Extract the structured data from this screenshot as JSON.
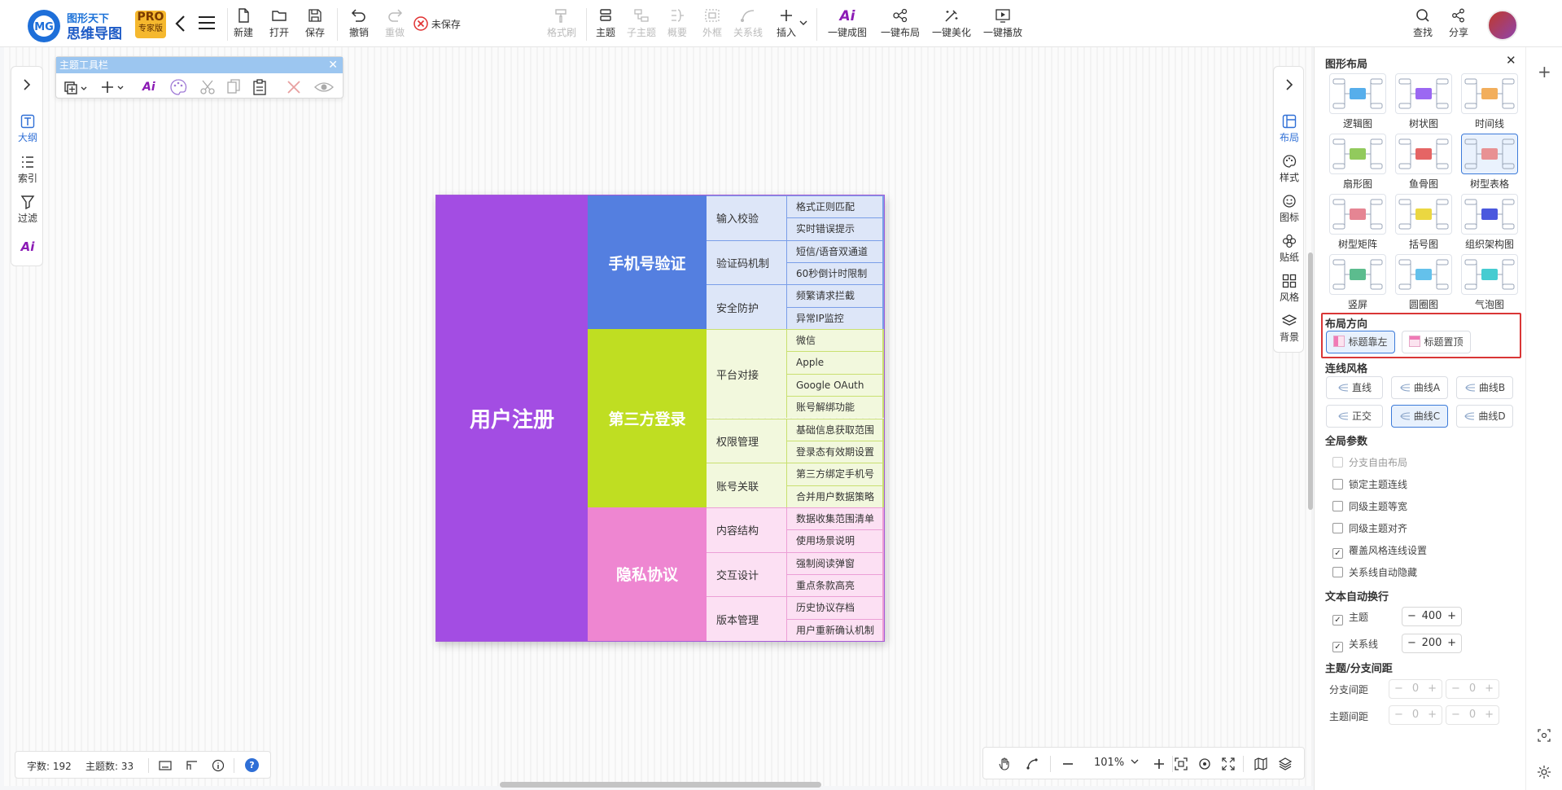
{
  "app": {
    "brand_top": "图形天下",
    "brand_name": "思维导图",
    "badge_pro": "PRO",
    "badge_edition": "专家版",
    "unsaved_label": "未保存"
  },
  "toolbar": {
    "new": "新建",
    "open": "打开",
    "save": "保存",
    "undo": "撤销",
    "redo": "重做",
    "format_brush": "格式刷",
    "topic": "主题",
    "subtopic": "子主题",
    "summary": "概要",
    "boundary": "外框",
    "relation": "关系线",
    "insert": "插入",
    "ai_map": "一键成图",
    "ai_map_icon": "Ai",
    "auto_layout": "一键布局",
    "auto_beautify": "一键美化",
    "auto_play": "一键播放",
    "find": "查找",
    "share": "分享"
  },
  "left_sidebar": {
    "outline": "大纲",
    "index": "索引",
    "filter": "过滤",
    "ai": "Ai"
  },
  "topic_toolbar": {
    "title": "主题工具栏",
    "ai": "Ai"
  },
  "right_nav": {
    "layout": "布局",
    "style": "样式",
    "icon": "图标",
    "sticker": "贴纸",
    "theme": "风格",
    "background": "背景"
  },
  "panel": {
    "layout_title": "图形布局",
    "layouts": [
      "逻辑图",
      "树状图",
      "时间线",
      "扇形图",
      "鱼骨图",
      "树型表格",
      "树型矩阵",
      "括号图",
      "组织架构图",
      "竖屏",
      "圆圈图",
      "气泡图"
    ],
    "selected_layout": "树型表格",
    "direction_title": "布局方向",
    "direction_options": [
      "标题靠左",
      "标题置顶"
    ],
    "selected_direction": "标题靠左",
    "line_style_title": "连线风格",
    "line_styles": [
      "直线",
      "曲线A",
      "曲线B",
      "正交",
      "曲线C",
      "曲线D"
    ],
    "selected_line_style": "曲线C",
    "global_title": "全局参数",
    "global_options": [
      {
        "label": "分支自由布局",
        "checked": false,
        "disabled": true
      },
      {
        "label": "锁定主题连线",
        "checked": false,
        "disabled": false
      },
      {
        "label": "同级主题等宽",
        "checked": false,
        "disabled": false
      },
      {
        "label": "同级主题对齐",
        "checked": false,
        "disabled": false
      },
      {
        "label": "覆盖风格连线设置",
        "checked": true,
        "disabled": false
      },
      {
        "label": "关系线自动隐藏",
        "checked": false,
        "disabled": false
      }
    ],
    "wrap_title": "文本自动换行",
    "wrap_topic_label": "主题",
    "wrap_topic_value": "400",
    "wrap_relation_label": "关系线",
    "wrap_relation_value": "200",
    "spacing_title": "主题/分支间距",
    "branch_spacing_label": "分支间距",
    "topic_spacing_label": "主题间距",
    "spacing_value": "0",
    "minus": "−",
    "plus": "+"
  },
  "status": {
    "char_count": "字数: 192",
    "topic_count": "主题数: 33",
    "help": "?"
  },
  "zoom": {
    "level": "101%"
  },
  "mindmap": {
    "root": "用户注册",
    "branches": [
      {
        "label": "手机号验证",
        "color": "#547fe0",
        "light": "#dde6f8",
        "line": "#7a9ee8",
        "children": [
          {
            "label": "输入校验",
            "items": [
              "格式正则匹配",
              "实时错误提示"
            ]
          },
          {
            "label": "验证码机制",
            "items": [
              "短信/语音双通道",
              "60秒倒计时限制"
            ]
          },
          {
            "label": "安全防护",
            "items": [
              "频繁请求拦截",
              "异常IP监控"
            ]
          }
        ]
      },
      {
        "label": "第三方登录",
        "color": "#bfde22",
        "light": "#f2f8dd",
        "line": "#c9e070",
        "children": [
          {
            "label": "平台对接",
            "items": [
              "微信",
              "Apple",
              "Google OAuth",
              "账号解绑功能"
            ]
          },
          {
            "label": "权限管理",
            "items": [
              "基础信息获取范围",
              "登录态有效期设置"
            ]
          },
          {
            "label": "账号关联",
            "items": [
              "第三方绑定手机号",
              "合并用户数据策略"
            ]
          }
        ]
      },
      {
        "label": "隐私协议",
        "color": "#ee86d1",
        "light": "#fce0f3",
        "line": "#ec9fd6",
        "children": [
          {
            "label": "内容结构",
            "items": [
              "数据收集范围清单",
              "使用场景说明"
            ]
          },
          {
            "label": "交互设计",
            "items": [
              "强制阅读弹窗",
              "重点条款高亮"
            ]
          },
          {
            "label": "版本管理",
            "items": [
              "历史协议存档",
              "用户重新确认机制"
            ]
          }
        ]
      }
    ]
  }
}
